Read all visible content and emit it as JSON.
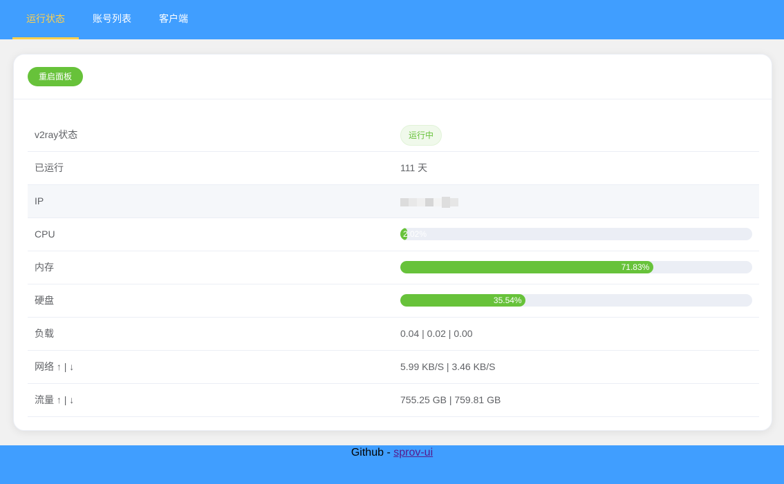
{
  "nav": {
    "items": [
      {
        "label": "运行状态",
        "active": true
      },
      {
        "label": "账号列表",
        "active": false
      },
      {
        "label": "客户端",
        "active": false
      }
    ]
  },
  "card": {
    "restart_label": "重启面板"
  },
  "status": {
    "v2ray_label": "v2ray状态",
    "v2ray_value": "运行中",
    "uptime_label": "已运行",
    "uptime_value": "111 天",
    "ip_label": "IP",
    "cpu_label": "CPU",
    "cpu_percent": 2.02,
    "cpu_text": "2.02%",
    "mem_label": "内存",
    "mem_percent": 71.83,
    "mem_text": "71.83%",
    "disk_label": "硬盘",
    "disk_percent": 35.54,
    "disk_text": "35.54%",
    "load_label": "负载",
    "load_value": "0.04 | 0.02 | 0.00",
    "net_label": "网络 ↑ | ↓",
    "net_value": "5.99 KB/S | 3.46 KB/S",
    "traffic_label": "流量 ↑ | ↓",
    "traffic_value": "755.25 GB | 759.81 GB"
  },
  "footer": {
    "prefix": "Github - ",
    "link_text": "sprov-ui"
  },
  "colors": {
    "primary": "#409eff",
    "active_nav": "#ffd04b",
    "success": "#67c23a",
    "track": "#ebeef5"
  }
}
